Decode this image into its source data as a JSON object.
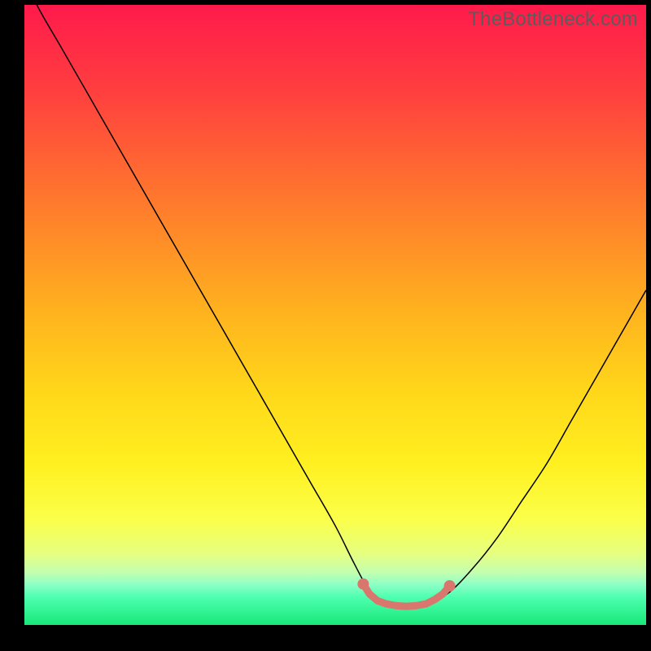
{
  "watermark": "TheBottleneck.com",
  "chart_data": {
    "type": "line",
    "title": "",
    "xlabel": "",
    "ylabel": "",
    "xlim": [
      0,
      100
    ],
    "ylim": [
      0,
      100
    ],
    "gradient": {
      "stops": [
        {
          "pct": 0,
          "color": "#ff1a4b"
        },
        {
          "pct": 14,
          "color": "#ff3f3f"
        },
        {
          "pct": 32,
          "color": "#ff7a2c"
        },
        {
          "pct": 50,
          "color": "#ffb41e"
        },
        {
          "pct": 62,
          "color": "#ffd61a"
        },
        {
          "pct": 74,
          "color": "#fff020"
        },
        {
          "pct": 83,
          "color": "#fbff4a"
        },
        {
          "pct": 88.5,
          "color": "#e6ff80"
        },
        {
          "pct": 91.5,
          "color": "#c4ffb0"
        },
        {
          "pct": 93.5,
          "color": "#8cffc6"
        },
        {
          "pct": 95.5,
          "color": "#4effb0"
        },
        {
          "pct": 100,
          "color": "#17e878"
        }
      ]
    },
    "series": [
      {
        "name": "bottleneck-curve",
        "color": "#000000",
        "width": 1.5,
        "x": [
          0,
          2,
          6,
          10,
          14,
          18,
          22,
          26,
          30,
          34,
          38,
          42,
          46,
          50,
          53,
          55.5,
          58,
          61,
          64,
          68,
          72,
          76,
          80,
          84,
          88,
          92,
          96,
          100
        ],
        "y": [
          105,
          100,
          93,
          86,
          79,
          72,
          65,
          58,
          51,
          44,
          37,
          30,
          23,
          16,
          10,
          5.5,
          3.3,
          3,
          3.2,
          5,
          9,
          14,
          20,
          26,
          33,
          40,
          47,
          54
        ]
      }
    ],
    "highlight": {
      "name": "minimum-band",
      "color": "#d9776f",
      "points": [
        {
          "x": 54.5,
          "y": 6.6
        },
        {
          "x": 55.5,
          "y": 5.0
        },
        {
          "x": 56.8,
          "y": 3.9
        },
        {
          "x": 58.2,
          "y": 3.4
        },
        {
          "x": 59.8,
          "y": 3.1
        },
        {
          "x": 61.4,
          "y": 3.0
        },
        {
          "x": 63.0,
          "y": 3.1
        },
        {
          "x": 64.6,
          "y": 3.4
        },
        {
          "x": 66.0,
          "y": 4.1
        },
        {
          "x": 67.3,
          "y": 5.0
        },
        {
          "x": 68.4,
          "y": 6.3
        }
      ],
      "dot_radius": 5.5,
      "stroke_width": 9
    }
  }
}
